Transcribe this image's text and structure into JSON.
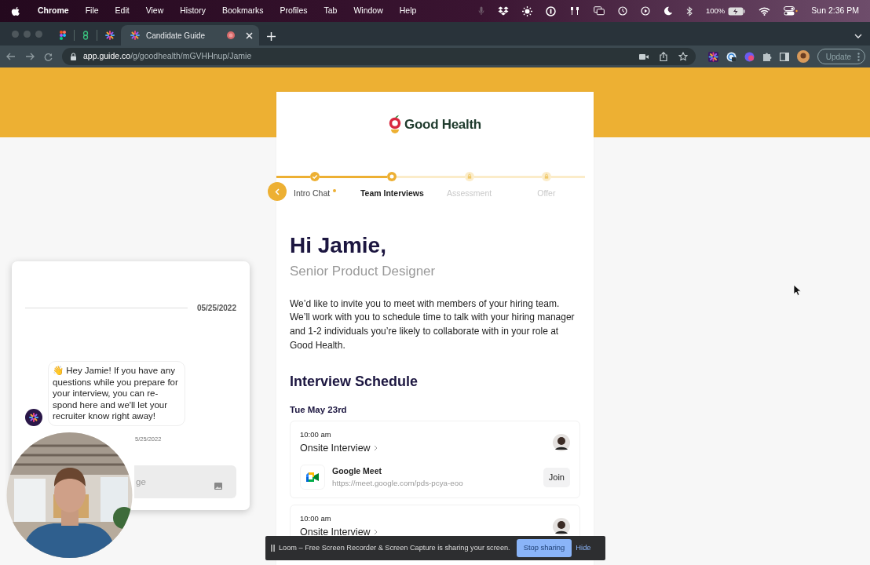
{
  "menu_bar": {
    "app": "Chrome",
    "items": [
      "File",
      "Edit",
      "View",
      "History",
      "Bookmarks",
      "Profiles",
      "Tab",
      "Window",
      "Help"
    ],
    "battery": "100%",
    "clock": "Sun 2:36 PM"
  },
  "browser": {
    "tabs": [
      {
        "title": "Candidate Guide",
        "selected": true
      }
    ],
    "address": {
      "host": "app.guide.co",
      "path": "/g/goodhealth/mGVHHnup/Jamie"
    },
    "update_button": "Update"
  },
  "guide": {
    "brand": "Good Health",
    "steps": [
      {
        "label": "Intro Chat",
        "completed": true,
        "selected": false,
        "locked": false,
        "dot": true
      },
      {
        "label": "Team Interviews",
        "completed": false,
        "selected": true,
        "locked": false,
        "dot": false
      },
      {
        "label": "Assessment",
        "completed": false,
        "selected": false,
        "locked": true,
        "dot": false
      },
      {
        "label": "Offer",
        "completed": false,
        "selected": false,
        "locked": true,
        "dot": false
      }
    ],
    "greeting": "Hi Jamie,",
    "role": "Senior Product Designer",
    "intro": "We’d like to invite you to meet with members of your hiring team. We’ll work with you to schedule time to talk with your hiring manager and 1-2 individuals you’re likely to collaborate with in your role at Good Health.",
    "schedule_title": "Interview Schedule",
    "date": "Tue May 23rd",
    "interviews": [
      {
        "time": "10:00 am",
        "title": "Onsite Interview",
        "tool": "Google Meet",
        "link": "https://meet.google.com/pds-pcya-eoo",
        "join": "Join"
      },
      {
        "time": "10:00 am",
        "title": "Onsite Interview"
      }
    ]
  },
  "chat": {
    "date": "05/25/2022",
    "message": "👋 Hey Jamie! If you have any questions while you prepare for your interview, you can re-spond here and we'll let your recruiter know right away!",
    "sent_time": "5/25/2022",
    "placeholder": "ge"
  },
  "share_bar": {
    "message": "Loom – Free Screen Recorder & Screen Capture is sharing your screen.",
    "stop": "Stop sharing",
    "hide": "Hide"
  }
}
